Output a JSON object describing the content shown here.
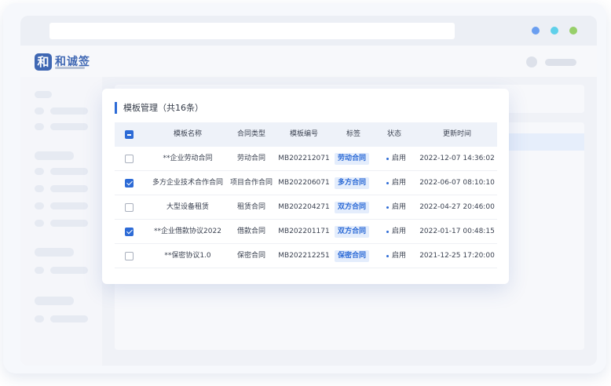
{
  "colors": {
    "accent": "#2d6bd6",
    "dot_blue": "#6a9ef0",
    "dot_cyan": "#5fd0ea",
    "dot_green": "#97cf6a",
    "logo": "#3f67b3"
  },
  "app": {
    "logo_glyph": "和",
    "logo_text": "和诚签"
  },
  "card": {
    "title": "模板管理（共16条）"
  },
  "table": {
    "headers": {
      "name": "模板名称",
      "type": "合同类型",
      "code": "模板编号",
      "tag": "标签",
      "status": "状态",
      "updated": "更新时间"
    },
    "rows": [
      {
        "checked": false,
        "name": "**企业劳动合同",
        "type": "劳动合同",
        "code": "MB202212071",
        "tag": "劳动合同",
        "status": "启用",
        "updated": "2022-12-07 14:36:02"
      },
      {
        "checked": true,
        "name": "多方企业技术合作合同",
        "type": "项目合作合同",
        "code": "MB202206071",
        "tag": "多方合同",
        "status": "启用",
        "updated": "2022-06-07 08:10:10"
      },
      {
        "checked": false,
        "name": "大型设备租赁",
        "type": "租赁合同",
        "code": "MB202204271",
        "tag": "双方合同",
        "status": "启用",
        "updated": "2022-04-27 20:46:00"
      },
      {
        "checked": true,
        "name": "**企业借款协议2022",
        "type": "借款合同",
        "code": "MB202201171",
        "tag": "双方合同",
        "status": "启用",
        "updated": "2022-01-17 00:48:15"
      },
      {
        "checked": false,
        "name": "**保密协议1.0",
        "type": "保密合同",
        "code": "MB202212251",
        "tag": "保密合同",
        "status": "启用",
        "updated": "2021-12-25 17:20:00"
      }
    ]
  }
}
